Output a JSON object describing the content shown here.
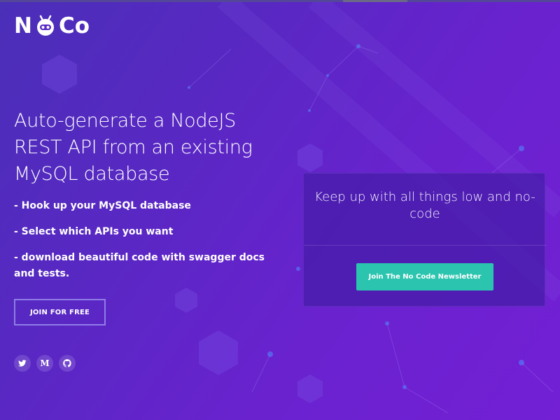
{
  "brand": {
    "logo_left": "N",
    "logo_right": "Co",
    "accent": "#2bc4ae",
    "background_start": "#4a2fb8",
    "background_end": "#7320d4"
  },
  "hero": {
    "headline": "Auto-generate a NodeJS REST API from an existing MySQL database",
    "bullets": [
      "- Hook up your MySQL database",
      "- Select which APIs you want",
      "- download beautiful code with swagger docs and tests."
    ],
    "join_button_label": "JOIN FOR FREE"
  },
  "social": [
    {
      "icon": "twitter-icon"
    },
    {
      "icon": "medium-icon",
      "glyph": "M"
    },
    {
      "icon": "github-icon"
    }
  ],
  "newsletter": {
    "title": "Keep up with all things low and no-code",
    "button_label": "Join The No Code Newsletter"
  }
}
